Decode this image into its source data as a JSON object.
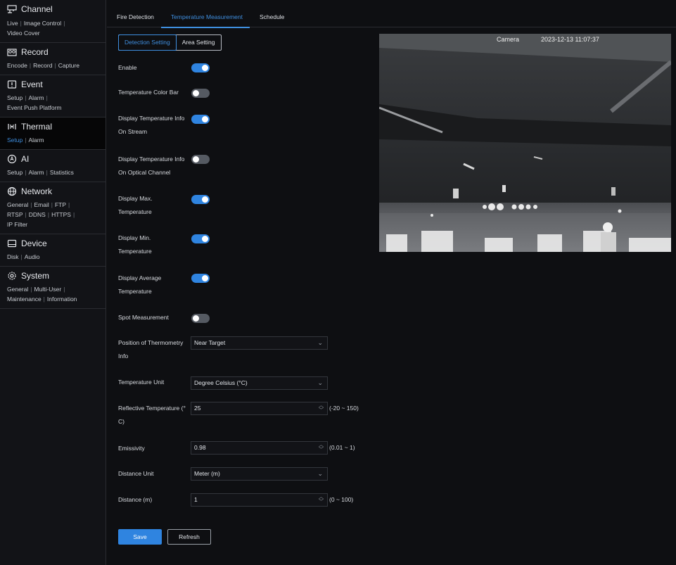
{
  "sidebar": {
    "channel": {
      "title": "Channel",
      "links": [
        "Live",
        "Image Control",
        "Video Cover"
      ]
    },
    "record": {
      "title": "Record",
      "links": [
        "Encode",
        "Record",
        "Capture"
      ]
    },
    "event": {
      "title": "Event",
      "links": [
        "Setup",
        "Alarm",
        "Event Push Platform"
      ]
    },
    "thermal": {
      "title": "Thermal",
      "links": [
        "Setup",
        "Alarm"
      ]
    },
    "ai": {
      "title": "AI",
      "links": [
        "Setup",
        "Alarm",
        "Statistics"
      ]
    },
    "network": {
      "title": "Network",
      "links": [
        "General",
        "Email",
        "FTP",
        "RTSP",
        "DDNS",
        "HTTPS",
        "IP Filter"
      ]
    },
    "device": {
      "title": "Device",
      "links": [
        "Disk",
        "Audio"
      ]
    },
    "system": {
      "title": "System",
      "links": [
        "General",
        "Multi-User",
        "Maintenance",
        "Information"
      ]
    }
  },
  "tabs": [
    "Fire Detection",
    "Temperature Measurement",
    "Schedule"
  ],
  "subtabs": [
    "Detection Setting",
    "Area Setting"
  ],
  "settings": {
    "enable": {
      "label": "Enable",
      "on": true
    },
    "color_bar": {
      "label": "Temperature Color Bar",
      "on": false
    },
    "info_stream": {
      "label1": "Display Temperature Info",
      "label2": "On Stream",
      "on": true
    },
    "info_optical": {
      "label1": "Display Temperature Info",
      "label2": "On Optical Channel",
      "on": false
    },
    "max_temp": {
      "label1": "Display Max.",
      "label2": "Temperature",
      "on": true
    },
    "min_temp": {
      "label1": "Display Min.",
      "label2": "Temperature",
      "on": true
    },
    "avg_temp": {
      "label1": "Display Average",
      "label2": "Temperature",
      "on": true
    },
    "spot": {
      "label": "Spot Measurement",
      "on": false
    }
  },
  "fields": {
    "position": {
      "label1": "Position of Thermometry",
      "label2": "Info",
      "value": "Near Target"
    },
    "temp_unit": {
      "label": "Temperature Unit",
      "value": "Degree Celsius (°C)"
    },
    "reflective": {
      "label1": "Reflective Temperature (°",
      "label2": "C)",
      "value": "25",
      "range": "(-20 ~ 150)"
    },
    "emissivity": {
      "label": "Emissivity",
      "value": "0.98",
      "range": "(0.01 ~ 1)"
    },
    "distance_unit": {
      "label": "Distance Unit",
      "value": "Meter (m)"
    },
    "distance": {
      "label": "Distance (m)",
      "value": "1",
      "range": "(0 ~ 100)"
    }
  },
  "buttons": {
    "save": "Save",
    "refresh": "Refresh"
  },
  "video": {
    "camera": "Camera",
    "timestamp": "2023-12-13 11:07:37"
  },
  "colors": {
    "accent": "#2f84e0",
    "background": "#0e0f12",
    "toggle_off": "#555a62"
  }
}
